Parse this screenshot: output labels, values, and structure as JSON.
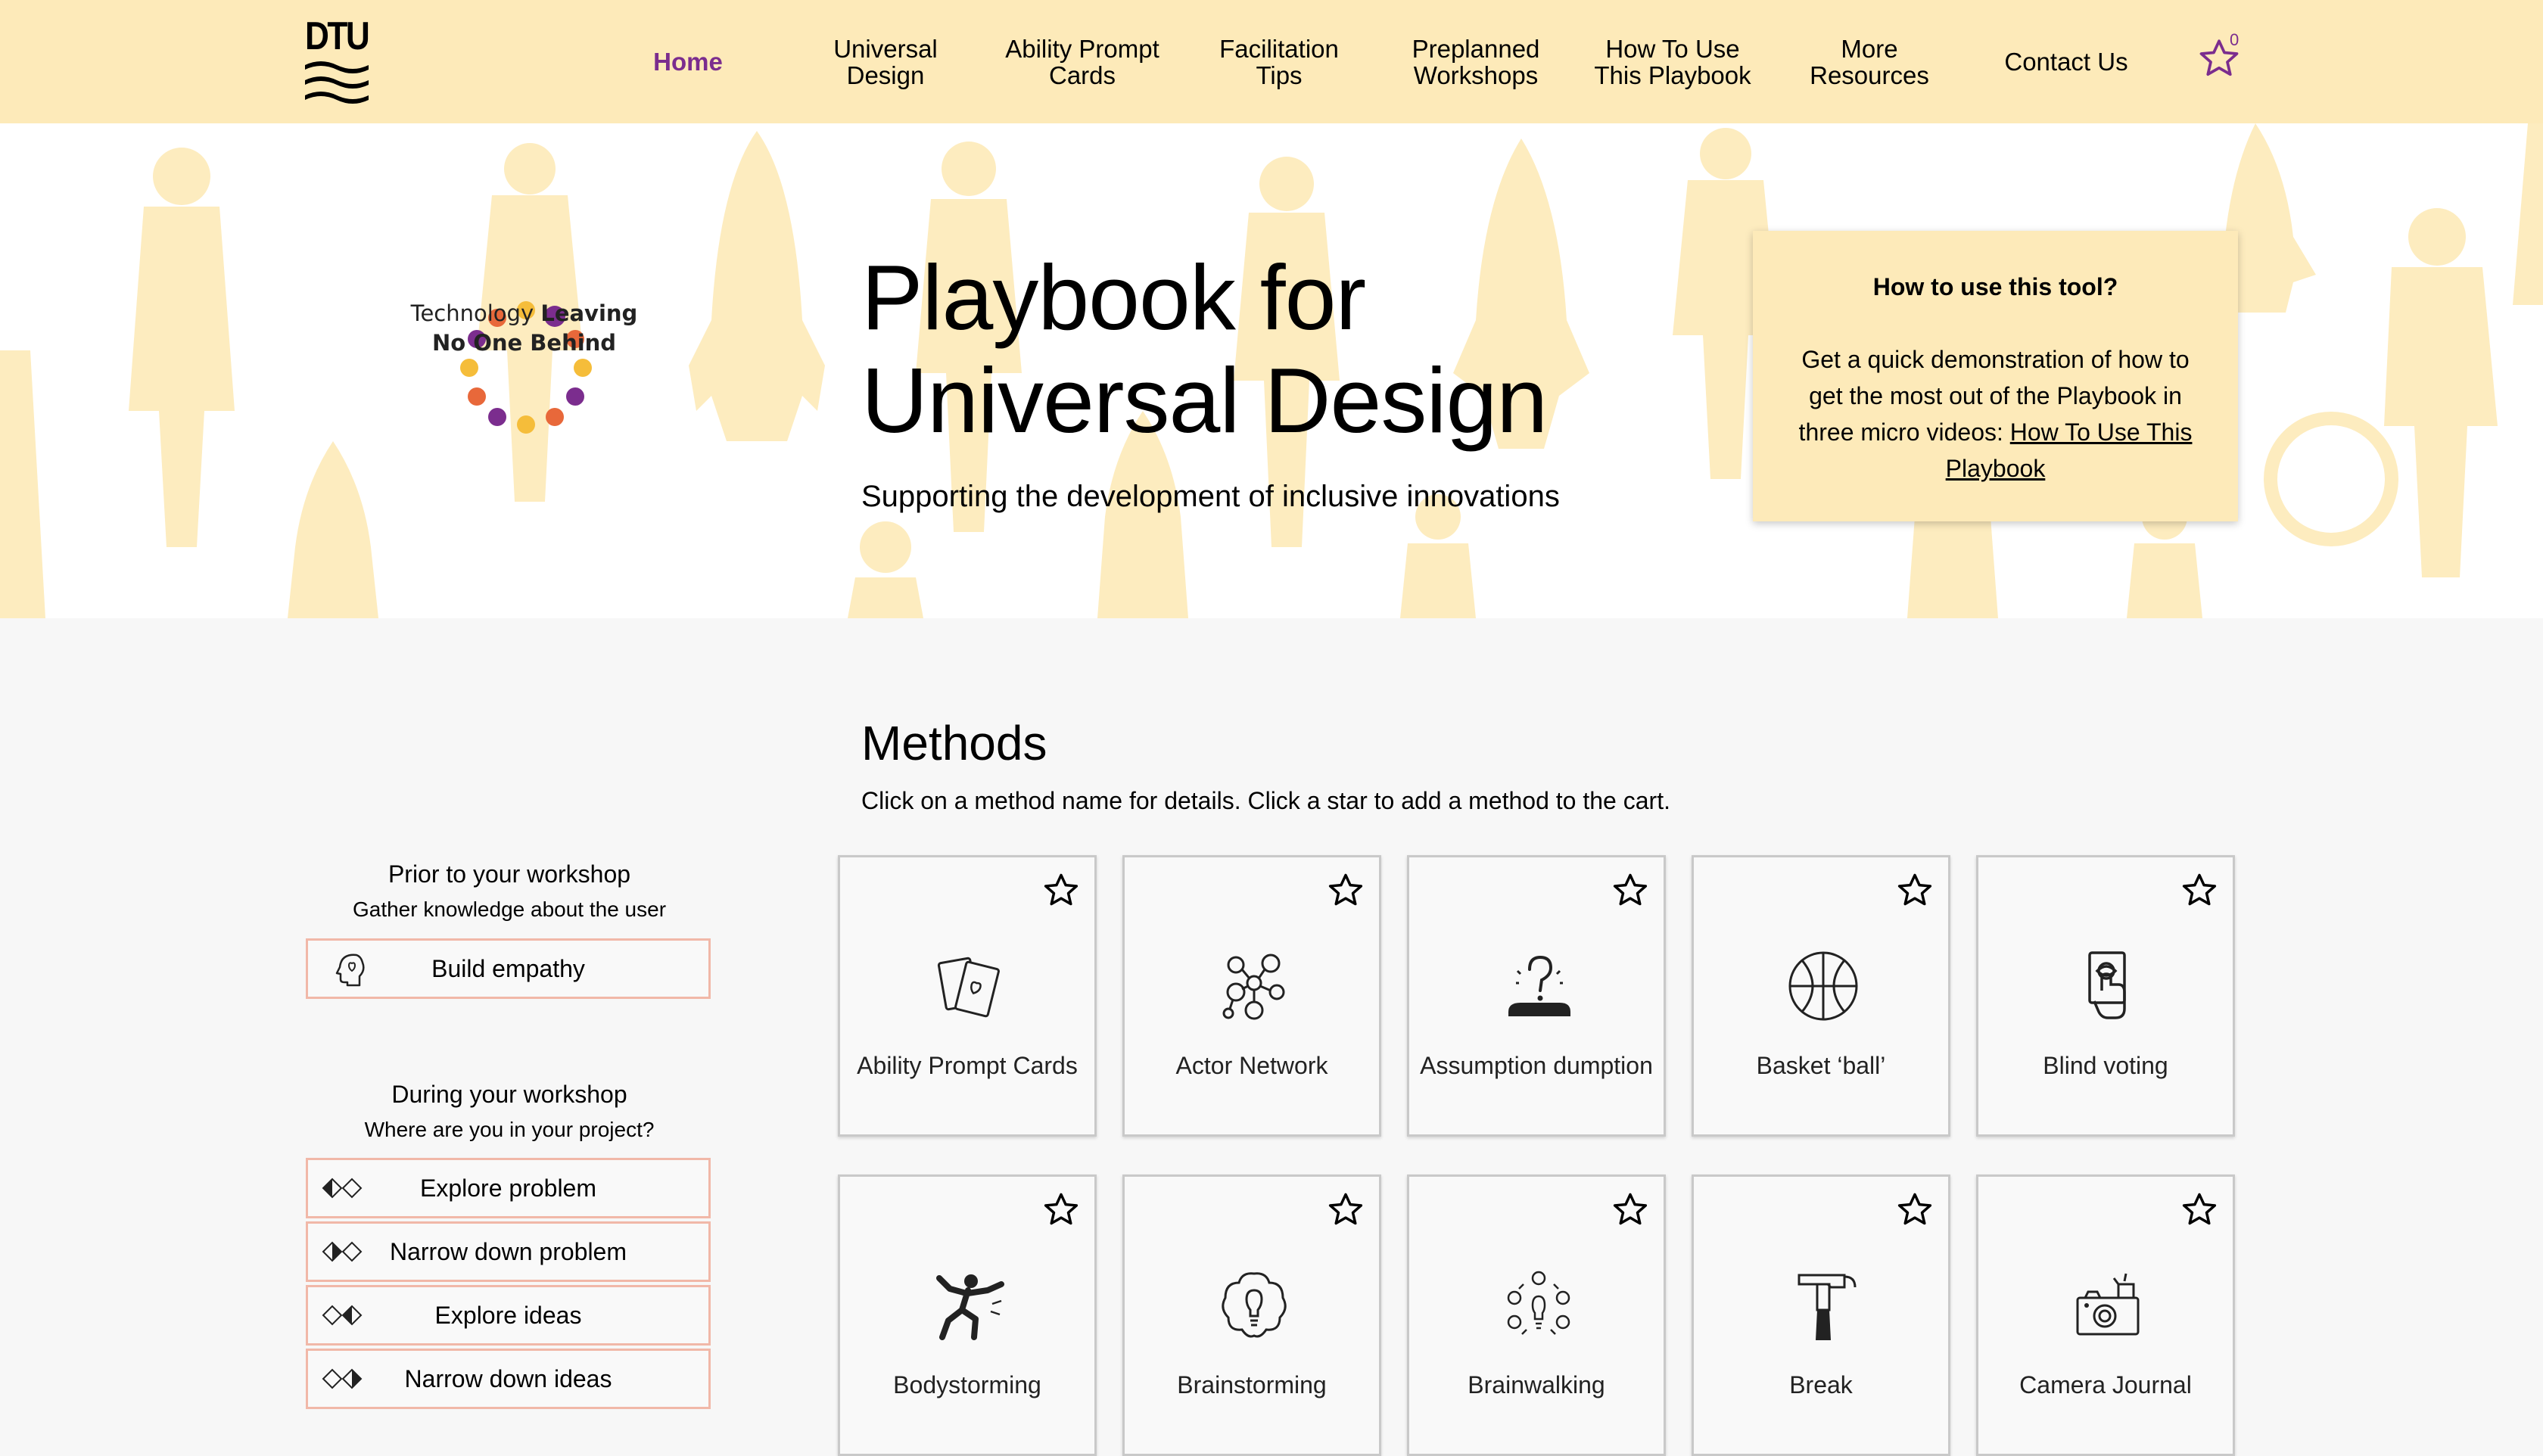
{
  "header": {
    "logo_text": "DTU",
    "nav": [
      {
        "label": "Home",
        "active": true
      },
      {
        "label": "Universal Design"
      },
      {
        "label": "Ability Prompt Cards"
      },
      {
        "label": "Facilitation Tips"
      },
      {
        "label": "Preplanned Workshops"
      },
      {
        "label": "How To Use This Playbook"
      },
      {
        "label": "More Resources"
      },
      {
        "label": "Contact Us"
      }
    ],
    "cart_count": "0",
    "icons": {
      "cart": "star-outline-icon"
    }
  },
  "hero": {
    "brand_line1_plain": "Technology ",
    "brand_line1_bold": "Leaving",
    "brand_line2": "No One Behind",
    "title_line1": "Playbook for",
    "title_line2": "Universal Design",
    "subtitle": "Supporting the development of inclusive innovations",
    "help": {
      "title": "How to use this tool?",
      "body": "Get a quick demonstration of how to get the most out of the Playbook in three micro videos: ",
      "link": "How To Use This Playbook"
    }
  },
  "methods": {
    "title": "Methods",
    "instructions": "Click on a method name for details. Click a star to add a method to the cart.",
    "cards": [
      {
        "name": "Ability Prompt Cards",
        "icon": "cards-icon"
      },
      {
        "name": "Actor Network",
        "icon": "network-icon"
      },
      {
        "name": "Assumption dumption",
        "icon": "question-icon"
      },
      {
        "name": "Basket ‘ball’",
        "icon": "basketball-icon"
      },
      {
        "name": "Blind voting",
        "icon": "voting-icon"
      },
      {
        "name": "Bodystorming",
        "icon": "body-icon"
      },
      {
        "name": "Brainstorming",
        "icon": "brain-icon"
      },
      {
        "name": "Brainwalking",
        "icon": "brainwalk-icon"
      },
      {
        "name": "Break",
        "icon": "hammer-icon"
      },
      {
        "name": "Camera Journal",
        "icon": "camera-icon"
      }
    ]
  },
  "sidebar": {
    "prior_title": "Prior to your workshop",
    "prior_sub": "Gather knowledge about the user",
    "prior_items": [
      {
        "label": "Build empathy",
        "icon": "empathy-head-icon"
      }
    ],
    "during_title": "During your workshop",
    "during_sub": "Where are you in your project?",
    "during_items": [
      {
        "label": "Explore problem",
        "icon": "diamond-phase-1-icon"
      },
      {
        "label": "Narrow down problem",
        "icon": "diamond-phase-2-icon"
      },
      {
        "label": "Explore ideas",
        "icon": "diamond-phase-3-icon"
      },
      {
        "label": "Narrow down ideas",
        "icon": "diamond-phase-4-icon"
      }
    ]
  },
  "colors": {
    "header_bg": "#fdeab9",
    "accent_purple": "#7b2d8e",
    "card_border": "#c9c9c9",
    "phase_border": "#f1b8a8"
  }
}
